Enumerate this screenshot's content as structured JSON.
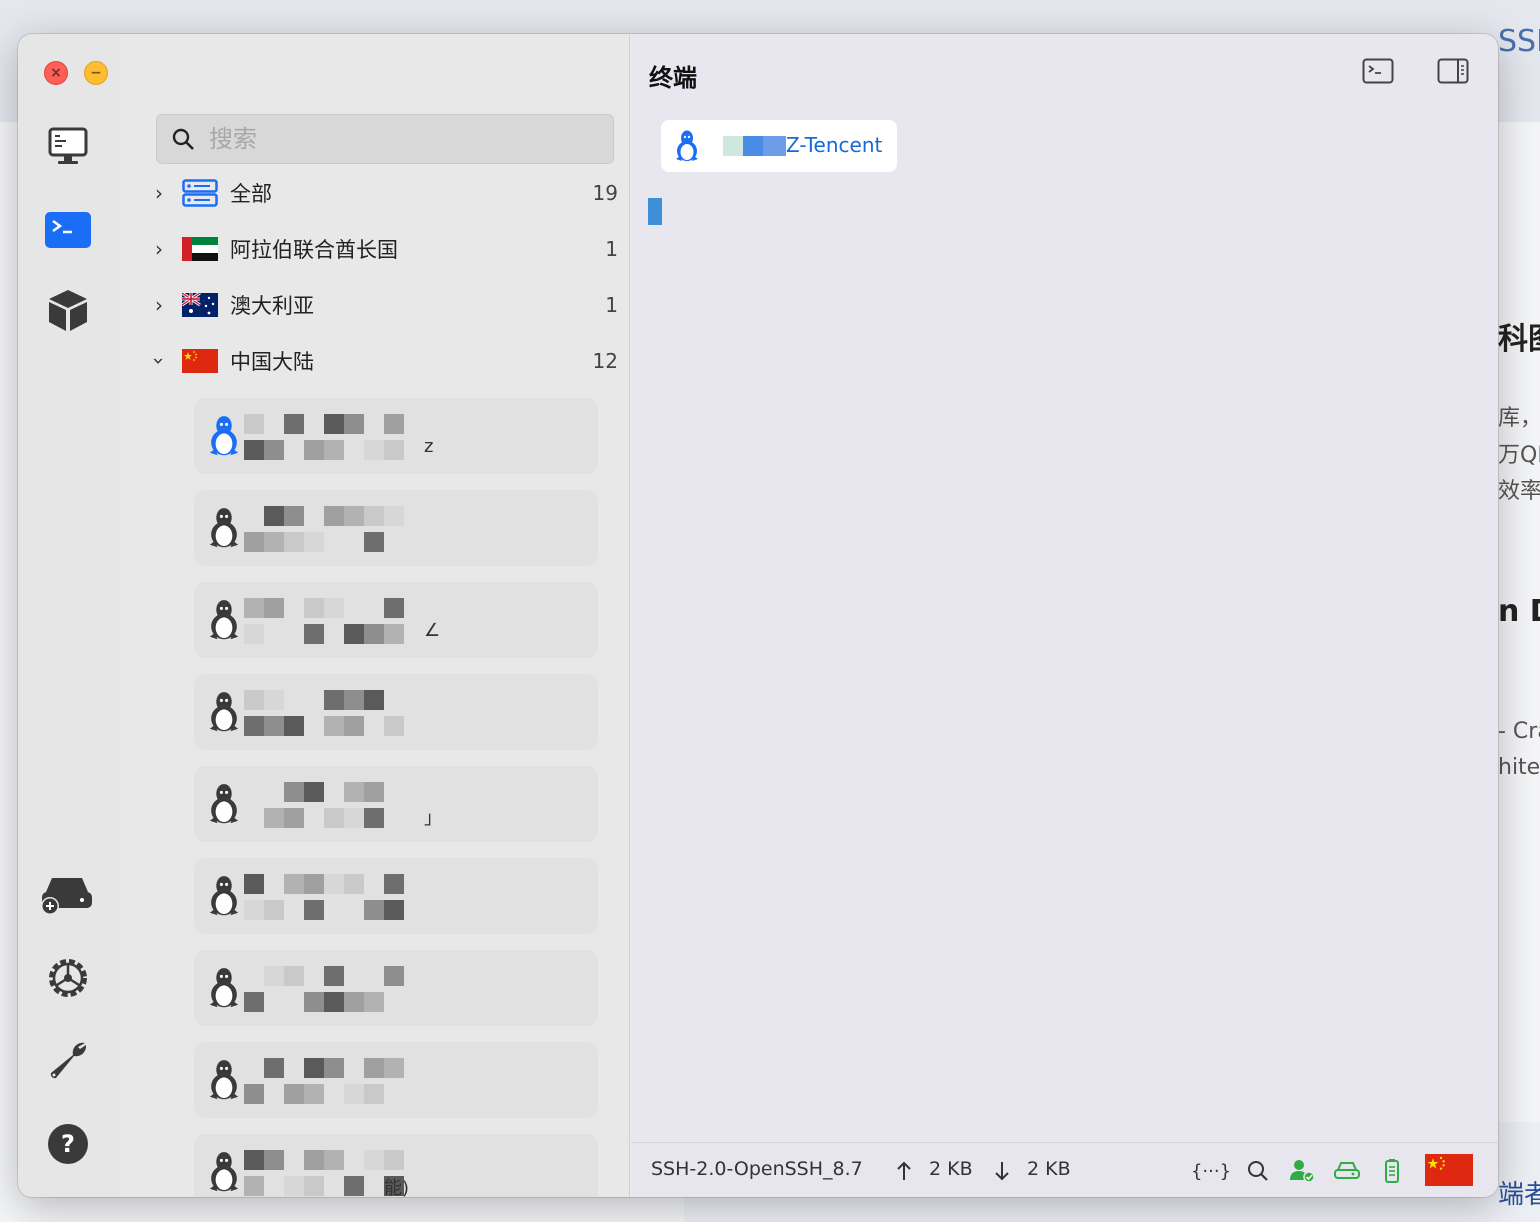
{
  "background": {
    "top_fragment": "SSH",
    "fragments": [
      "科图",
      "库，",
      "万QF",
      "效率",
      "n D",
      "- Cra",
      "hite",
      "端者"
    ]
  },
  "window": {
    "search": {
      "placeholder": "搜索",
      "value": ""
    },
    "groups": [
      {
        "label": "全部",
        "count": "19",
        "expanded": false,
        "icon": "server-stack-icon"
      },
      {
        "label": "阿拉伯联合酋长国",
        "count": "1",
        "expanded": false,
        "icon": "uae-flag"
      },
      {
        "label": "澳大利亚",
        "count": "1",
        "expanded": false,
        "icon": "australia-flag"
      },
      {
        "label": "中国大陆",
        "count": "12",
        "expanded": true,
        "icon": "china-flag"
      }
    ],
    "hosts_visible_fragments": [
      "z",
      "∠",
      "」",
      "能)"
    ],
    "main": {
      "title": "终端",
      "tab_label": "Z-Tencent",
      "status": {
        "protocol": "SSH-2.0-OpenSSH_8.7",
        "upload": "2 KB",
        "download": "2 KB",
        "snippet_icon": "{···}"
      }
    }
  },
  "colors": {
    "accent": "#1769d6",
    "cursor": "#3d90d8",
    "status_green": "#2eae42"
  }
}
